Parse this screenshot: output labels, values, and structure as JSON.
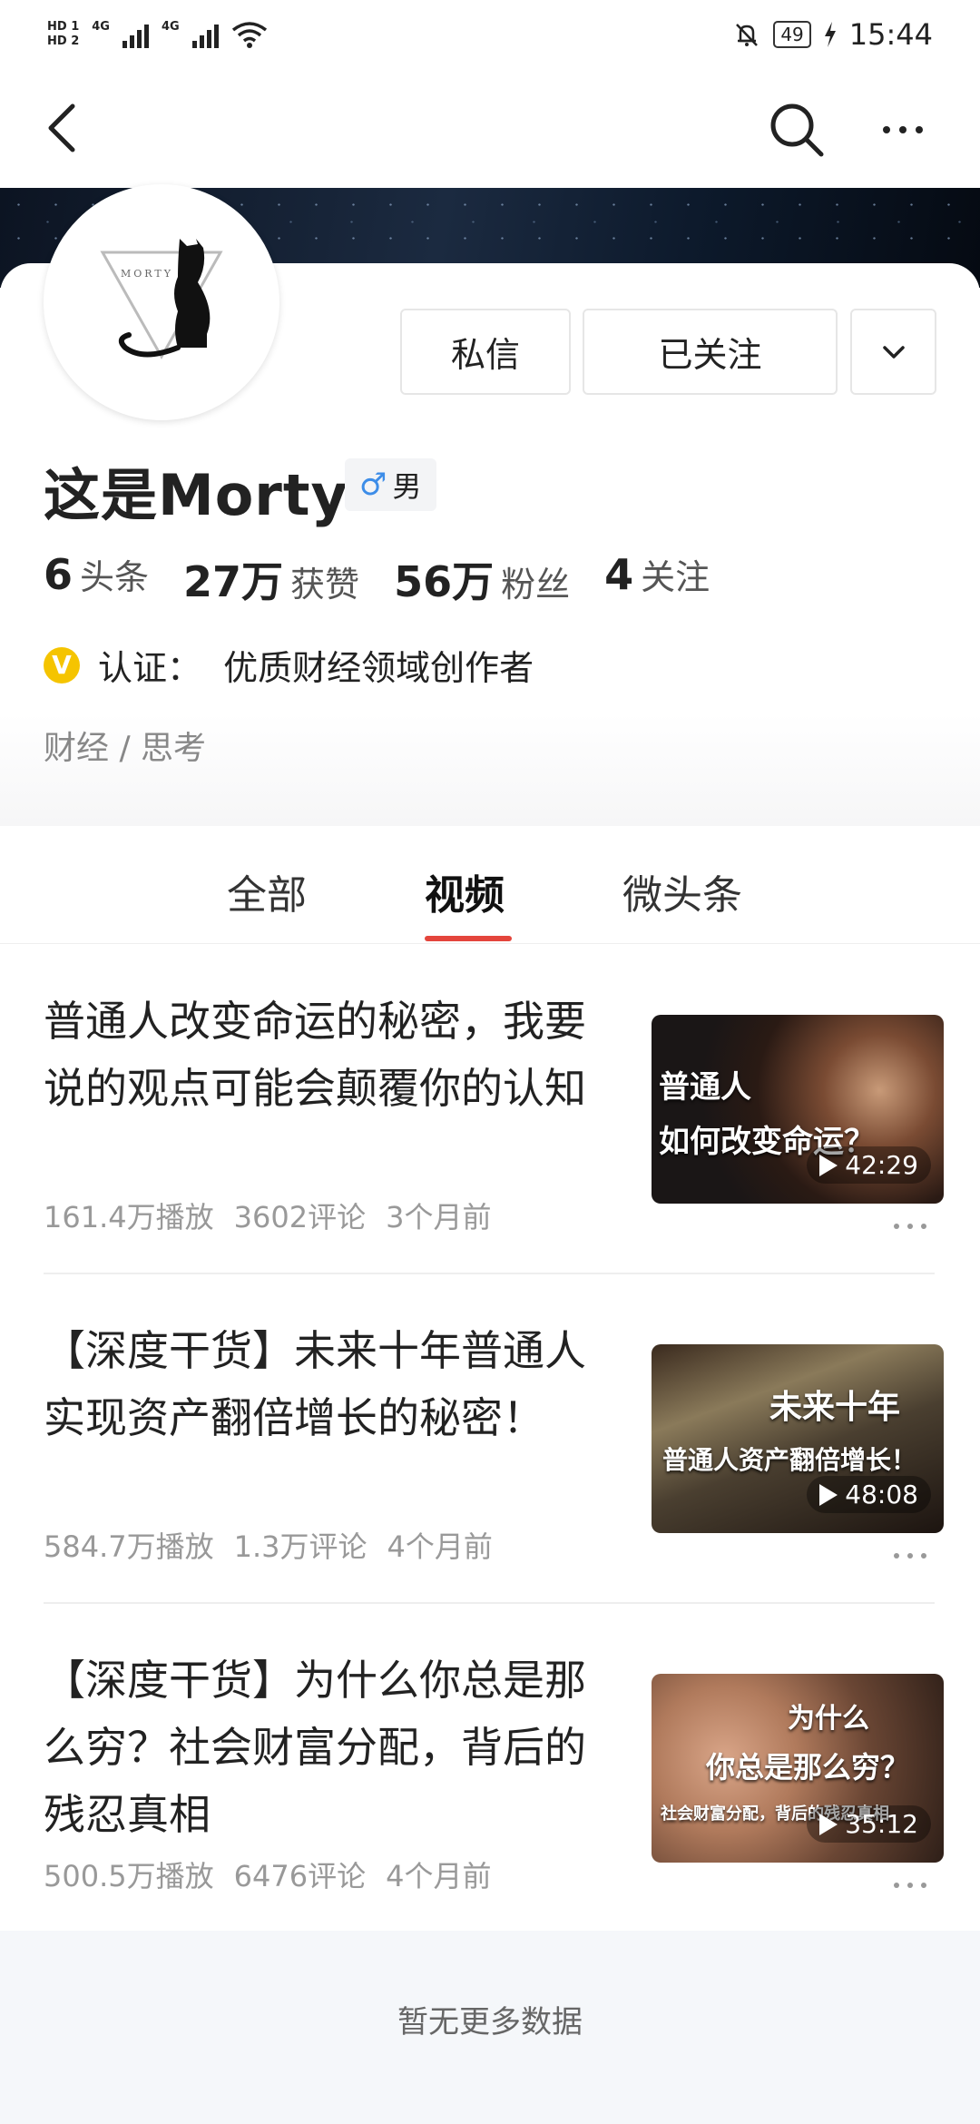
{
  "status_bar": {
    "sim1": "HD 1",
    "sim2": "HD 2",
    "net1": "4G",
    "net2": "4G",
    "battery": "49",
    "time": "15:44"
  },
  "nav": {
    "back_icon": "chevron-left-icon",
    "search_icon": "search-icon",
    "more_icon": "more-horizontal-icon"
  },
  "profile": {
    "avatar_text": "MORTY",
    "name": "这是Morty",
    "gender_symbol": "♂",
    "gender": "男",
    "stats": [
      {
        "num": "6",
        "label": "头条"
      },
      {
        "num": "27万",
        "label": "获赞"
      },
      {
        "num": "56万",
        "label": "粉丝"
      },
      {
        "num": "4",
        "label": "关注"
      }
    ],
    "verify_badge": "V",
    "verify_text": "认证：  优质财经领域创作者",
    "tags": "财经 / 思考",
    "accent_color": "#e4453c"
  },
  "actions": {
    "message": "私信",
    "followed": "已关注",
    "dropdown_icon": "chevron-down-icon"
  },
  "tabs": [
    {
      "label": "全部",
      "active": false
    },
    {
      "label": "视频",
      "active": true
    },
    {
      "label": "微头条",
      "active": false
    }
  ],
  "feed": [
    {
      "title": "普通人改变命运的秘密，我要说的观点可能会颠覆你的认知",
      "views": "161.4万播放",
      "comments": "3602评论",
      "time": "3个月前",
      "thumb_line1": "普通人",
      "thumb_line2": "如何改变命运？",
      "duration": "42:29"
    },
    {
      "title": "【深度干货】未来十年普通人实现资产翻倍增长的秘密！",
      "views": "584.7万播放",
      "comments": "1.3万评论",
      "time": "4个月前",
      "thumb_line1": "未来十年",
      "thumb_line2": "普通人资产翻倍增长！",
      "duration": "48:08"
    },
    {
      "title": "【深度干货】为什么你总是那么穷？社会财富分配，背后的残忍真相",
      "views": "500.5万播放",
      "comments": "6476评论",
      "time": "4个月前",
      "thumb_line1": "为什么",
      "thumb_line2": "你总是那么穷？",
      "thumb_line3": "社会财富分配，背后的残忍真相",
      "duration": "35:12"
    }
  ],
  "footer": {
    "text": "暂无更多数据"
  }
}
